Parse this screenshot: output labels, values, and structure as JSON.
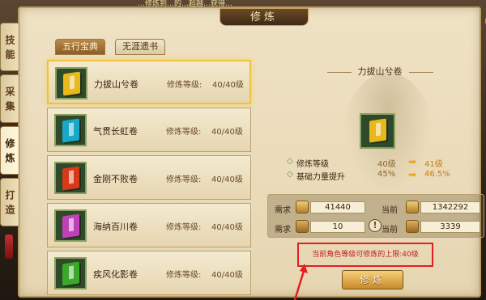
{
  "top_banner": {
    "text_prefix": "…修炼到…的…超越…获得…",
    "text_highlight": "…"
  },
  "window": {
    "title": "修炼",
    "close_glyph": "×"
  },
  "side_tabs": [
    {
      "label": "技能"
    },
    {
      "label": "采集"
    },
    {
      "label": "修炼"
    },
    {
      "label": "打造"
    }
  ],
  "book_tabs": {
    "active": "五行宝典",
    "inactive": "无涯遗书"
  },
  "books": [
    {
      "name": "力拔山兮卷",
      "level_label": "修炼等级:",
      "level": "40/40级",
      "color": "#e8b81c"
    },
    {
      "name": "气贯长虹卷",
      "level_label": "修炼等级:",
      "level": "40/40级",
      "color": "#1aa8c8"
    },
    {
      "name": "金刚不败卷",
      "level_label": "修炼等级:",
      "level": "40/40级",
      "color": "#d83a18"
    },
    {
      "name": "海纳百川卷",
      "level_label": "修炼等级:",
      "level": "40/40级",
      "color": "#c040b8"
    },
    {
      "name": "疾风化影卷",
      "level_label": "修炼等级:",
      "level": "40/40级",
      "color": "#3aa828"
    }
  ],
  "detail": {
    "title": "力拔山兮卷",
    "stats": [
      {
        "name": "修炼等级",
        "current": "40级",
        "next": "41级"
      },
      {
        "name": "基础力量提升",
        "current": "45%",
        "next": "46.5%"
      }
    ],
    "cost": {
      "row1": {
        "label": "需求",
        "required": "41440",
        "current_label": "当前",
        "current": "1342292"
      },
      "row2": {
        "label": "需求",
        "required": "10",
        "current_label": "当前",
        "current": "3339"
      }
    },
    "notice": "当前角色等级可修炼的上限:40级",
    "notice_icon": "!",
    "train_button": "修炼"
  }
}
